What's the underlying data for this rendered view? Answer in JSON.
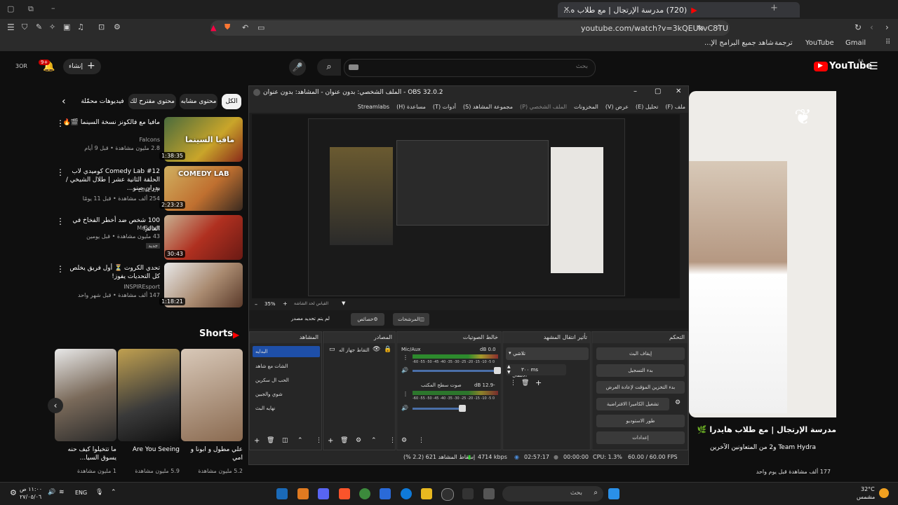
{
  "browser": {
    "tab_title": "(720) مدرسة الإرتجال | مع طلاب ه...",
    "url": "youtube.com/watch?v=3kQEUkvC8TU",
    "bookmarks": [
      "Gmail",
      "YouTube",
      "ترجمة",
      "شاهد جميع البرامج الإ..."
    ]
  },
  "youtube": {
    "logo": "YouTube",
    "logo_region": "SA",
    "create_label": "إنشاء",
    "notif_count": "9+",
    "search_placeholder": "بحث",
    "chips": [
      "الكل",
      "محتوى مشابه",
      "محتوى مقترح لك",
      "فيديوهات محمّلة"
    ],
    "videos": [
      {
        "title": "مافيا مع فالكونز نسخة السينما 🎬🔥",
        "channel": "Falcons",
        "meta": "2.8 مليون مشاهدة • قبل 9 أيام",
        "duration": "1:38:35",
        "thumb_text": "مافيا السينما"
      },
      {
        "title": "Comedy Lab #12 كوميدي لاب الحلقة الثانية عشر | طلال الشيخي / بدران صنو...",
        "channel": "LINE UP",
        "meta": "254 ألف مشاهدة • قبل 11 يومًا",
        "duration": "2:23:23",
        "thumb_text": "COMEDY LAB"
      },
      {
        "title": "100 شخص ضد أخطر الفخاخ في العالم!",
        "channel": "MrBeast",
        "meta": "43 مليون مشاهدة • قبل يومين",
        "badge": "جديد",
        "duration": "30:43",
        "thumb_text": ""
      },
      {
        "title": "تحدي الكروت ⏳ أول فريق يخلص كل التحديات يفوز!",
        "channel": "INSPIREsport",
        "meta": "147 ألف مشاهدة • قبل شهر واحد",
        "duration": "1:18:21",
        "thumb_text": ""
      }
    ],
    "shorts_label": "Shorts",
    "shorts": [
      {
        "title": "علي مطول و ابونا و امي",
        "views": "5.2 مليون مشاهدة"
      },
      {
        "title": "Are You Seeing",
        "views": "5.9 مليون مشاهدة"
      },
      {
        "title": "ما تتخيلوا كيف حنه يسوق السيا...",
        "views": "1 مليون مشاهدة"
      }
    ],
    "now_playing": {
      "title": "مدرسة الإرتجال | مع طلاب هايدرا 🌿",
      "channel": "Team Hydra و2 من المتعاونين الآخرين",
      "views": "177 ألف مشاهدة  قبل يوم واحد"
    }
  },
  "obs": {
    "title": "OBS 32.0.2 - الملف الشخصي: بدون عنوان - المشاهد: بدون عنوان",
    "menu": [
      "ملف (F)",
      "تحليل (E)",
      "عرض (V)",
      "المخزونات",
      "الملف الشخصي (P)",
      "مجموعة المشاهد (S)",
      "أدوات (T)",
      "مساعدة (H)",
      "Streamlabs"
    ],
    "zoom": "35%",
    "preview_scale_label": "القياس لحد الشاشة",
    "source_none": "لم يتم تحديد مصدر",
    "props_label": "خصائص",
    "filters_label": "المرشحات",
    "docks": {
      "scenes": {
        "title": "المشاهد",
        "items": [
          "البدايه",
          "الشات مع شاهد",
          "الحب ال سكرين",
          "شوي والجبين",
          "نهايه البث"
        ]
      },
      "sources": {
        "title": "المصادر",
        "items": [
          "التقاط جهاز اله"
        ]
      },
      "mixer": {
        "title": "خالط الصوتيات",
        "ch1_name": "Mic/Aux",
        "ch1_db": "0.0 dB",
        "ch2_name": "صوت سطح المكتب",
        "ch2_db": "-12.9 dB",
        "ticks": "-60 -55 -50 -45 -40 -35 -30 -25 -20 -15 -10 -5 0"
      },
      "transitions": {
        "title": "تأثير انتقال المشهد",
        "type": "تلاشي",
        "duration_label": "مدة الانتقال",
        "duration_value": "٣٠٠ ms"
      },
      "controls": {
        "title": "التحكم",
        "buttons": [
          "إيقاف البث",
          "بدء التسجيل",
          "بدء التخزين المؤقت لإعادة العرض",
          "تشغيل الكاميرا الافتراضية",
          "طور الاستوديو",
          "إعدادات"
        ]
      }
    },
    "status": {
      "dropped": "إسقاط المشاهد 621 (2.2 %)",
      "bitrate": "4714 kbps",
      "live_time": "02:57:17",
      "rec_time": "00:00:00",
      "cpu": "CPU: 1.3%",
      "fps": "60.00 / 60.00 FPS"
    }
  },
  "taskbar": {
    "search_placeholder": "بحث",
    "lang": "ENG",
    "time": "١١:٠٠ ص",
    "date": "٢٧/٠٥/٠٦",
    "weather_temp": "32°C",
    "weather_desc": "مشمس"
  },
  "colors": {
    "youtube_red": "#ff0000",
    "obs_bg": "#1e1e1e",
    "meter_green": "#2d8a2d",
    "selected_blue": "#1e4fa8"
  }
}
